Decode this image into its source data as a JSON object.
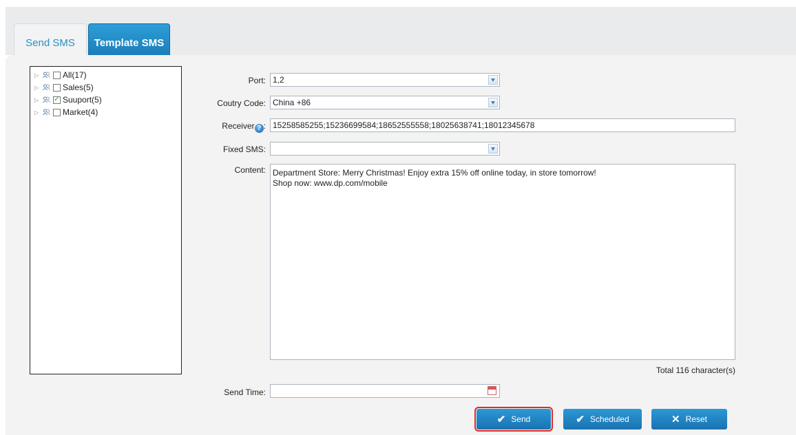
{
  "tabs": [
    {
      "label": "Send SMS",
      "active": false
    },
    {
      "label": "Template SMS",
      "active": true
    }
  ],
  "tree": {
    "items": [
      {
        "label": "All(17)",
        "checked": false
      },
      {
        "label": "Sales(5)",
        "checked": false
      },
      {
        "label": "Suuport(5)",
        "checked": true
      },
      {
        "label": "Market(4)",
        "checked": false
      }
    ]
  },
  "form": {
    "port": {
      "label": "Port:",
      "value": "1,2"
    },
    "country": {
      "label": "Coutry Code:",
      "value": "China  +86"
    },
    "receiver": {
      "label": "Receiver",
      "suffix": ":",
      "value": "15258585255;15236699584;18652555558;18025638741;18012345678"
    },
    "fixed_sms": {
      "label": "Fixed SMS:",
      "value": ""
    },
    "content": {
      "label": "Content:",
      "line1": "Department Store: Merry Christmas! Enjoy extra 15% off online today, in store tomorrow!",
      "line2": "Shop now: www.dp.com/mobile"
    },
    "char_total": "Total 116 character(s)",
    "send_time": {
      "label": "Send Time:",
      "value": ""
    }
  },
  "buttons": {
    "send": "Send",
    "scheduled": "Scheduled",
    "reset": "Reset"
  },
  "colors": {
    "accent": "#1f85c4",
    "highlight": "#e0282a"
  }
}
